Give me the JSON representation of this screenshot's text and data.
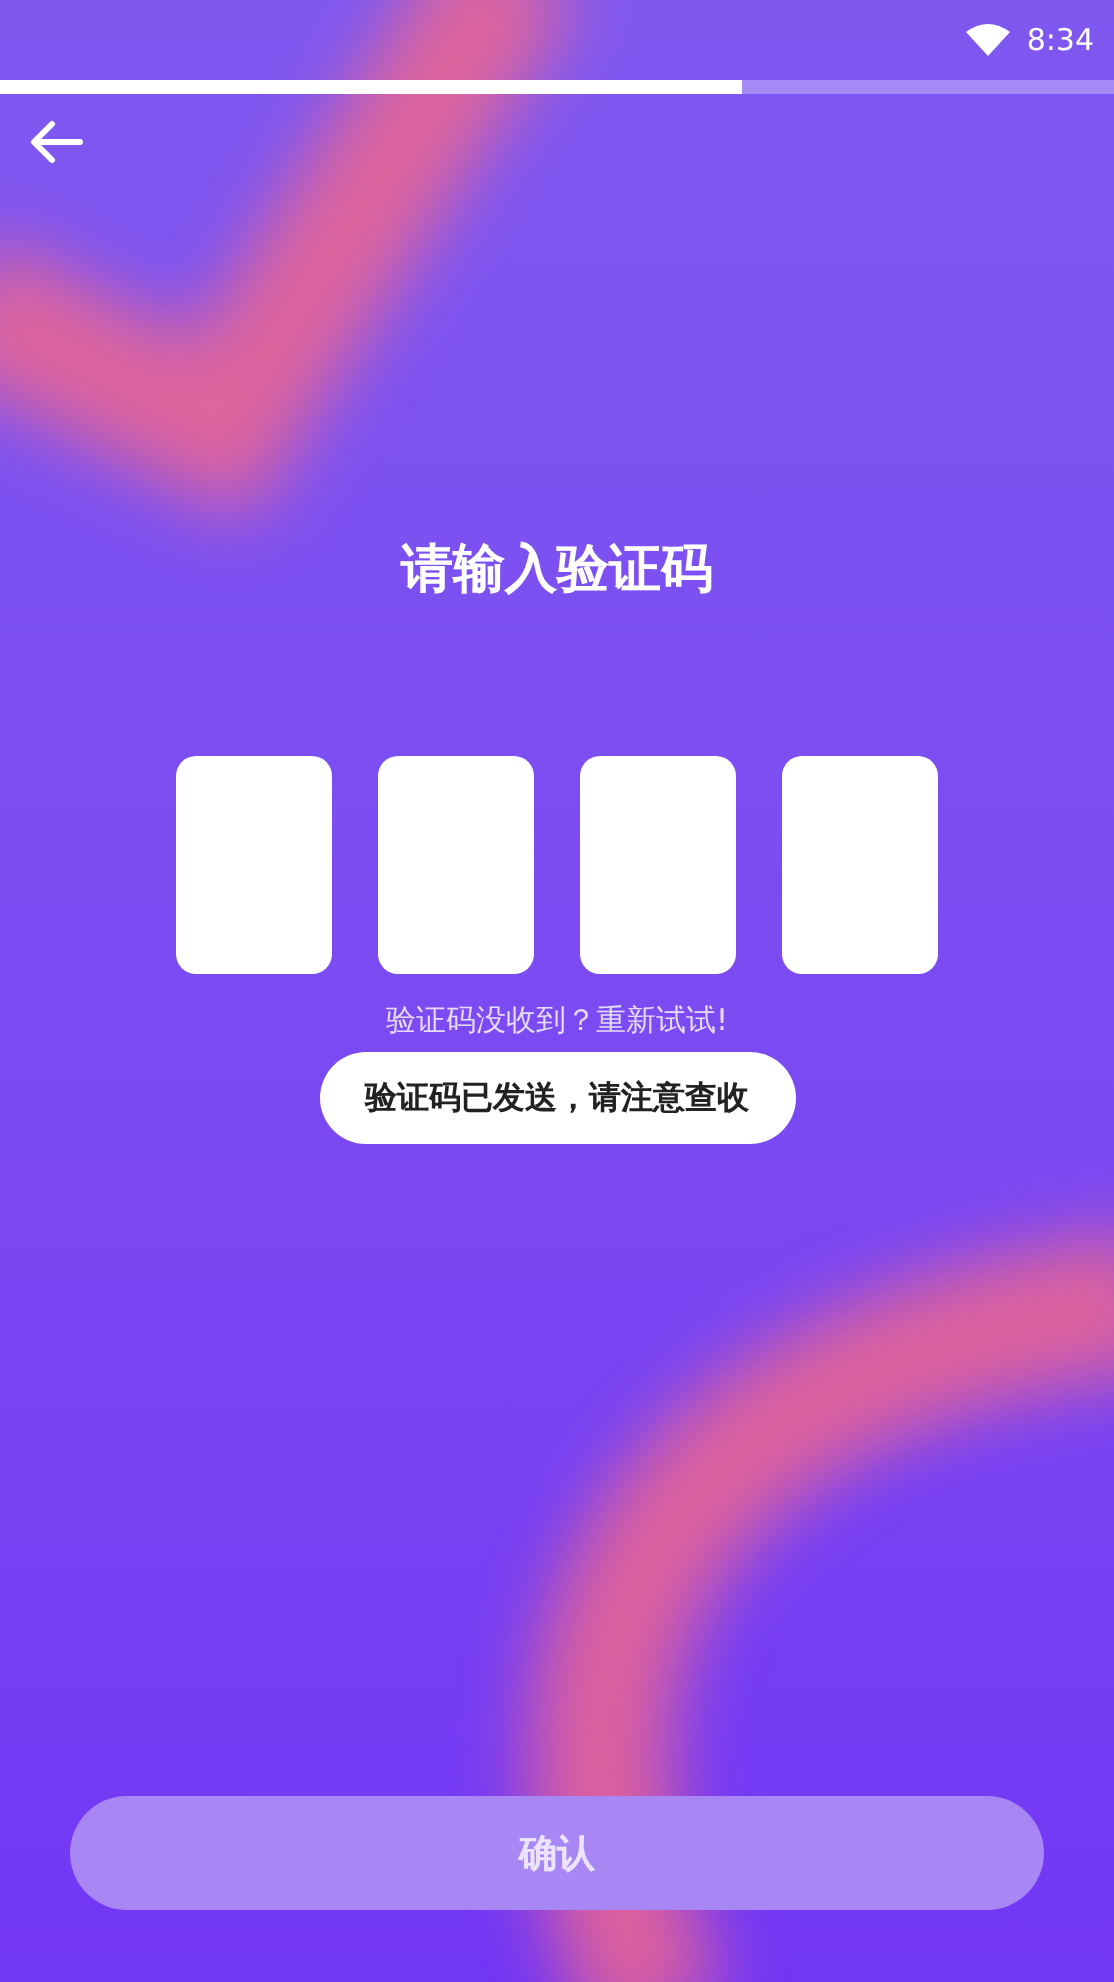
{
  "status_bar": {
    "time": "8:34"
  },
  "progress": {
    "level": 0.666
  },
  "title": "请输入验证码",
  "code_boxes": [
    {
      "filled": false
    },
    {
      "filled": false
    },
    {
      "filled": false
    },
    {
      "filled": false
    }
  ],
  "resend_hint": "验证码没收到？重新试试!",
  "toast": "验证码已发送，请注意查收",
  "confirm_button": {
    "label": "确认",
    "disabled": true
  }
}
